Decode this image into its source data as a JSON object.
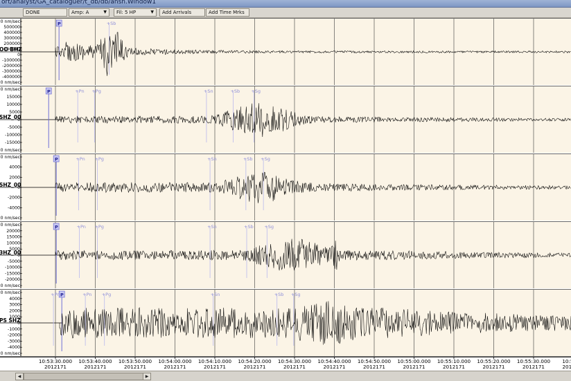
{
  "window": {
    "title": "ort/analyst/GA_cataloguer/t_db/db/ansn.Window1"
  },
  "toolbar": {
    "status": "DONE",
    "amp": "Amp: A",
    "fil": "Fil: 5 HP",
    "add_arrivals": "Add Arrivals",
    "add_time_marks": "Add Time Mrks"
  },
  "traces": [
    {
      "label": "OO BHZ",
      "amp_labels": [
        "0 nm/sec",
        "500000",
        "400000",
        "300000",
        "200000",
        "100000",
        "0",
        "-100000",
        "-200000",
        "-300000",
        "-400000",
        "0 nm/sec"
      ],
      "phases": [
        {
          "name": "P",
          "kind": "main",
          "t": "10:53:30.9"
        },
        {
          "name": "+Sb",
          "kind": "ghost",
          "t": "10:53:43.5"
        }
      ],
      "envelope": "early"
    },
    {
      "label": "SHZ_00",
      "amp_labels": [
        "0 nm/sec",
        "15000",
        "10000",
        "5000",
        "0",
        "-5000",
        "-10000",
        "-15000",
        "0 nm/sec"
      ],
      "phases": [
        {
          "name": "P",
          "kind": "main",
          "t": "10:53:28.3"
        },
        {
          "name": "+Pn",
          "kind": "ghost",
          "t": "10:53:35.6"
        },
        {
          "name": "+Pg",
          "kind": "ghost",
          "t": "10:53:39.8"
        },
        {
          "name": "+Sn",
          "kind": "ghost",
          "t": "10:54:07.9"
        },
        {
          "name": "+Sb",
          "kind": "ghost",
          "t": "10:54:14.6"
        },
        {
          "name": "+Sg",
          "kind": "ghost",
          "t": "10:54:19.8"
        }
      ],
      "envelope": "mid"
    },
    {
      "label": "SHZ_00",
      "amp_labels": [
        "0 nm/sec",
        "4000",
        "2000",
        "0",
        "-2000",
        "-4000",
        "0 nm/sec"
      ],
      "phases": [
        {
          "name": "P",
          "kind": "main",
          "t": "10:53:30.2"
        },
        {
          "name": "+Pn",
          "kind": "ghost",
          "t": "10:53:35.8"
        },
        {
          "name": "+Pg",
          "kind": "ghost",
          "t": "10:53:40.5"
        },
        {
          "name": "+Sn",
          "kind": "ghost",
          "t": "10:54:08.8"
        },
        {
          "name": "+Sb",
          "kind": "ghost",
          "t": "10:54:17.8"
        },
        {
          "name": "+Sg",
          "kind": "ghost",
          "t": "10:54:22.2"
        }
      ],
      "envelope": "mid"
    },
    {
      "label": "3HZ_00",
      "amp_labels": [
        "0 nm/sec",
        "20000",
        "15000",
        "10000",
        "5000",
        "0",
        "-5000",
        "-10000",
        "-15000",
        "-20000",
        "0 nm/sec"
      ],
      "phases": [
        {
          "name": "P",
          "kind": "main",
          "t": "10:53:30.2"
        },
        {
          "name": "+Pn",
          "kind": "ghost",
          "t": "10:53:36.0"
        },
        {
          "name": "+Pg",
          "kind": "ghost",
          "t": "10:53:40.5"
        },
        {
          "name": "+Sn",
          "kind": "ghost",
          "t": "10:54:08.8"
        },
        {
          "name": "+Sb",
          "kind": "ghost",
          "t": "10:54:18.0"
        },
        {
          "name": "+Sg",
          "kind": "ghost",
          "t": "10:54:23.1"
        }
      ],
      "envelope": "late"
    },
    {
      "label": "PS SHZ",
      "amp_labels": [
        "0 nm/sec",
        "4000",
        "3000",
        "2000",
        "1000",
        "0",
        "-1000",
        "-2000",
        "-3000",
        "-4000",
        "0 nm/sec"
      ],
      "phases": [
        {
          "name": "+Pn",
          "kind": "ghost",
          "t": "10:53:29.5"
        },
        {
          "name": "P",
          "kind": "main",
          "t": "10:53:31.6"
        },
        {
          "name": "+Pn",
          "kind": "ghost",
          "t": "10:53:37.5"
        },
        {
          "name": "+Pg",
          "kind": "ghost",
          "t": "10:53:42.3"
        },
        {
          "name": "+Sn",
          "kind": "ghost",
          "t": "10:54:09.6"
        },
        {
          "name": "+Sb",
          "kind": "ghost",
          "t": "10:54:25.6"
        },
        {
          "name": "+Sg",
          "kind": "ghost",
          "t": "10:54:29.8"
        }
      ],
      "envelope": "broad"
    }
  ],
  "time_axis": {
    "ticks": [
      "10:53:30.000",
      "10:53:40.000",
      "10:53:50.000",
      "10:54:00.000",
      "10:54:10.000",
      "10:54:20.000",
      "10:54:30.000",
      "10:54:40.000",
      "10:54:50.000",
      "10:55:00.000",
      "10:55:10.000",
      "10:55:20.000",
      "10:55:30.000",
      "10:55:40"
    ],
    "date": "2012171"
  },
  "colors": {
    "background": "#fbf4e6",
    "trace": "#000000",
    "grid": "#3a3a3a",
    "phase_main": "#6f6fd6",
    "phase_ghost": "#b9b9ee"
  }
}
